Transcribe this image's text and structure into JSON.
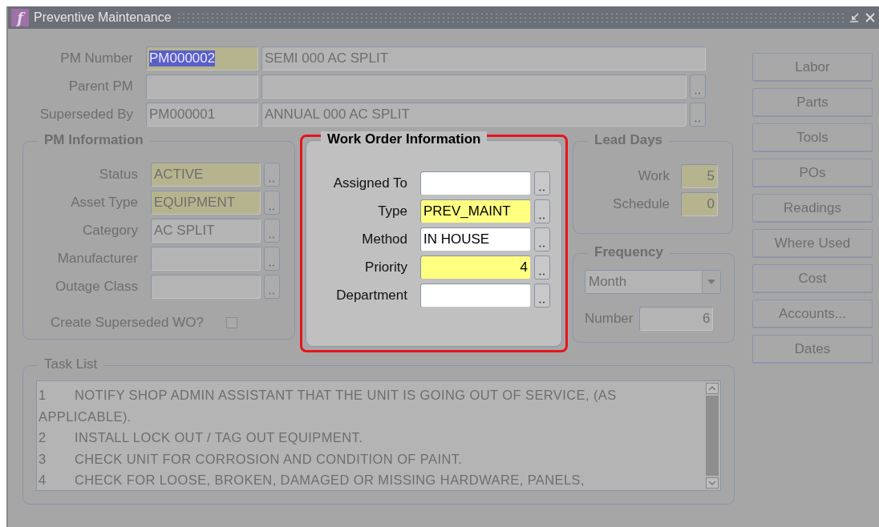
{
  "window": {
    "icon_glyph": "f",
    "title": "Preventive Maintenance"
  },
  "header": {
    "active": false,
    "rows": [
      {
        "label": "PM Number",
        "code": {
          "value": "PM000002",
          "required": true,
          "text_selected": true
        },
        "description": {
          "value": "SEMI 000 AC SPLIT"
        },
        "lookup": false
      },
      {
        "label": "Parent PM",
        "code": {
          "required": false
        },
        "description": {},
        "lookup": true
      },
      {
        "label": "Superseded By",
        "code": {
          "value": "PM000001",
          "required": false,
          "text_selected": false
        },
        "description": {
          "value": "ANNUAL 000 AC SPLIT"
        },
        "lookup": true
      }
    ]
  },
  "pm_information": {
    "title": "PM Information",
    "active": false,
    "fields": [
      {
        "label": "Status",
        "value": "ACTIVE",
        "required": true
      },
      {
        "label": "Asset Type",
        "value": "EQUIPMENT",
        "required": true
      },
      {
        "label": "Category",
        "value": "AC SPLIT",
        "required": false
      },
      {
        "label": "Manufacturer",
        "required": false
      },
      {
        "label": "Outage Class",
        "required": false
      }
    ],
    "checkbox": {
      "label": "Create Superseded WO?",
      "checked": false
    }
  },
  "work_order_information": {
    "title": "Work Order Information",
    "active": true,
    "highlighted": true,
    "fields": [
      {
        "label": "Assigned To",
        "required": false
      },
      {
        "label": "Type",
        "value": "PREV_MAINT",
        "required": true,
        "numeric": false
      },
      {
        "label": "Method",
        "value": "IN HOUSE",
        "required": false,
        "numeric": false
      },
      {
        "label": "Priority",
        "value": "4",
        "required": true,
        "numeric": true
      },
      {
        "label": "Department",
        "required": false
      }
    ]
  },
  "lead_days": {
    "title": "Lead Days",
    "active": false,
    "fields": [
      {
        "label": "Work",
        "value": "5",
        "required": true
      },
      {
        "label": "Schedule",
        "value": "0",
        "required": true
      }
    ]
  },
  "frequency": {
    "title": "Frequency",
    "active": false,
    "select": {
      "value": "Month"
    },
    "number": {
      "label": "Number",
      "value": "6"
    }
  },
  "buttons": [
    {
      "label": "Labor",
      "disabled": true
    },
    {
      "label": "Parts",
      "disabled": true
    },
    {
      "label": "Tools",
      "disabled": true
    },
    {
      "label": "POs",
      "disabled": true
    },
    {
      "label": "Readings",
      "disabled": true
    },
    {
      "label": "Where Used",
      "disabled": true
    },
    {
      "label": "Cost",
      "disabled": true
    },
    {
      "label": "Accounts...",
      "disabled": true
    },
    {
      "label": "Dates",
      "disabled": true
    }
  ],
  "task_list": {
    "title": "Task List",
    "active": false,
    "tasks": [
      {
        "number": "1",
        "text": "NOTIFY SHOP ADMIN ASSISTANT THAT THE UNIT IS GOING OUT OF SERVICE, (AS APPLICABLE)."
      },
      {
        "number": "2",
        "text": "INSTALL LOCK OUT / TAG OUT EQUIPMENT."
      },
      {
        "number": "3",
        "text": "CHECK UNIT FOR CORROSION AND CONDITION OF PAINT."
      },
      {
        "number": "4",
        "text": "CHECK FOR LOOSE, BROKEN, DAMAGED OR MISSING HARDWARE, PANELS,"
      }
    ]
  }
}
